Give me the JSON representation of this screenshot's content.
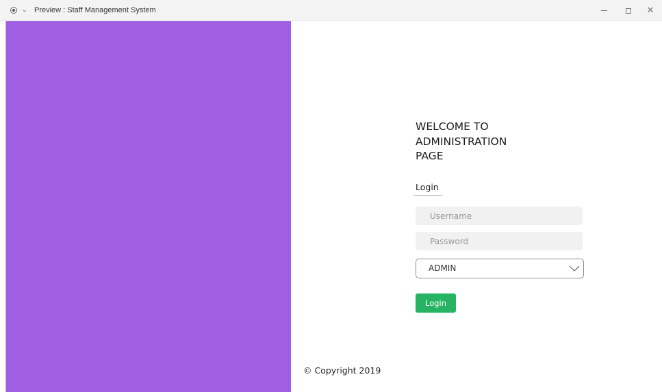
{
  "window": {
    "title": "Preview : Staff Management System",
    "controls": {
      "minimize_icon": "minimize-icon",
      "maximize_icon": "maximize-icon",
      "close_icon": "close-icon"
    }
  },
  "left_panel": {
    "color": "#a05ee3"
  },
  "welcome": {
    "line1": "WELCOME TO",
    "line2": "ADMINISTRATION",
    "line3": "PAGE"
  },
  "login_form": {
    "heading": "Login",
    "username": {
      "placeholder": "Username",
      "value": ""
    },
    "password": {
      "placeholder": "Password",
      "value": ""
    },
    "role_select": {
      "selected": "ADMIN"
    },
    "submit_label": "Login",
    "submit_color": "#26b463"
  },
  "footer": {
    "copyright": "© Copyright 2019"
  }
}
